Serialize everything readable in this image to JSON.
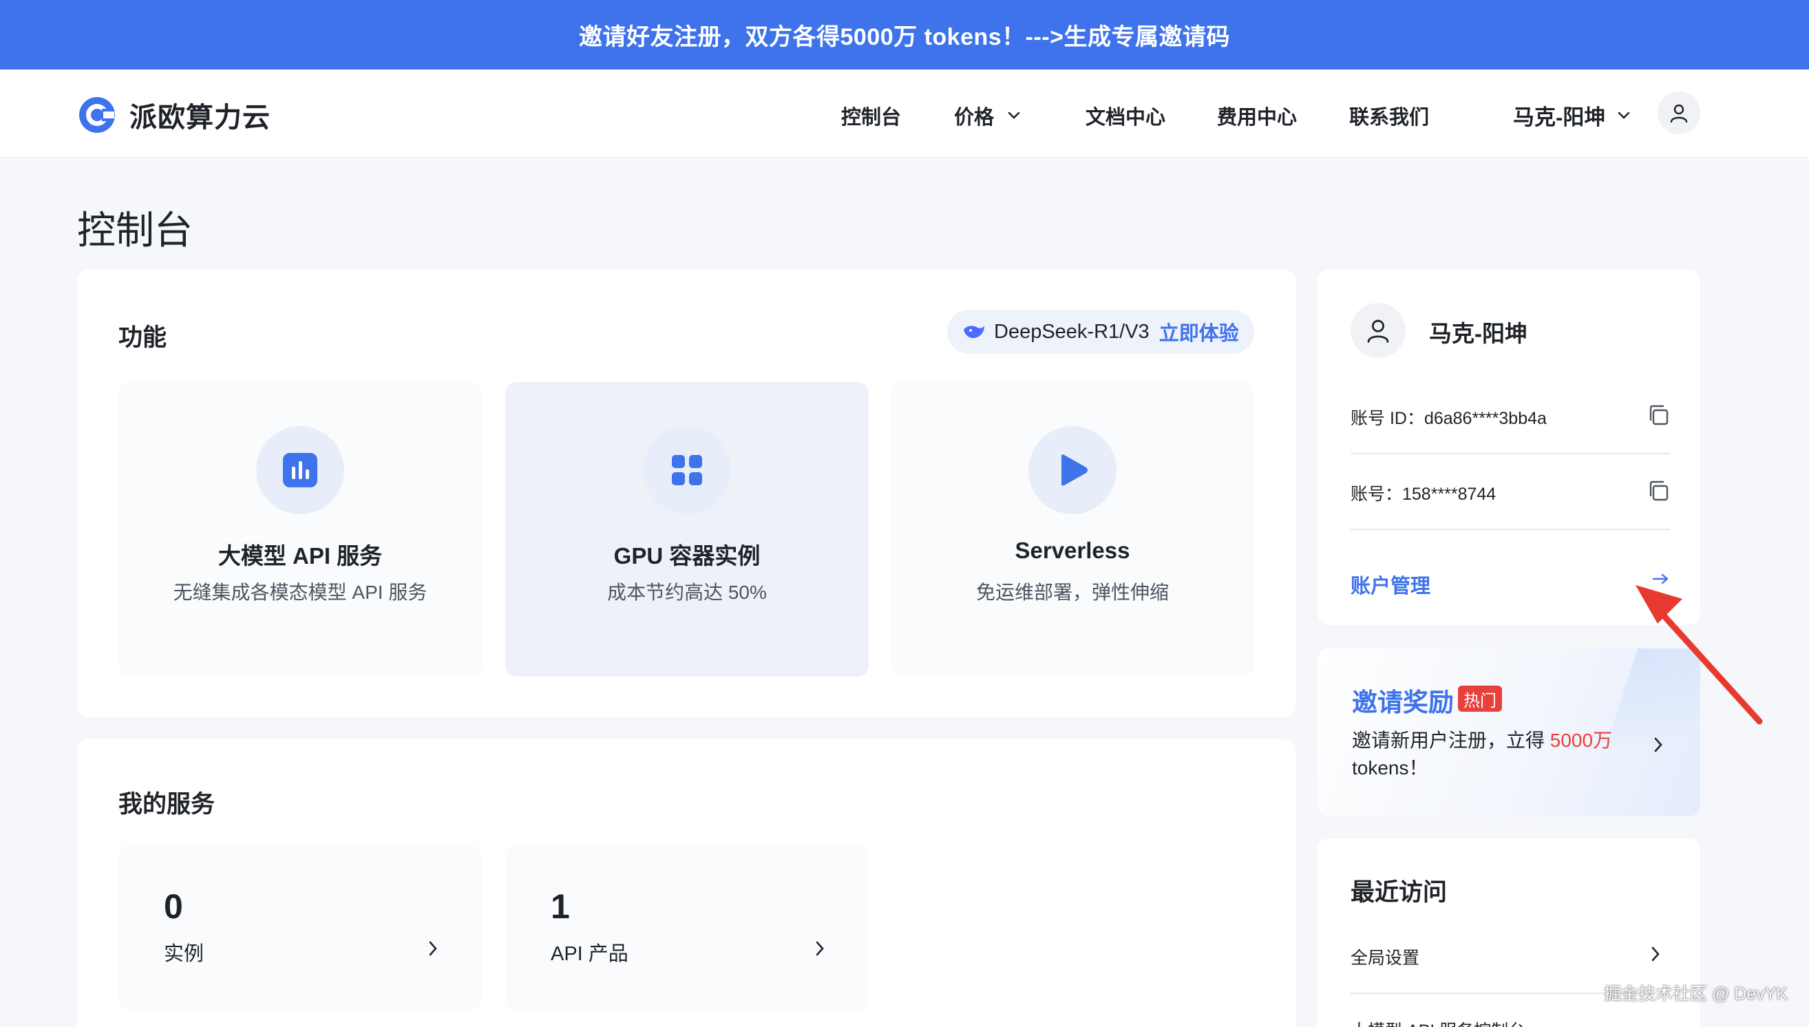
{
  "banner": {
    "text": "邀请好友注册，双方各得5000万 tokens！--->生成专属邀请码"
  },
  "header": {
    "brand": "派欧算力云",
    "nav": [
      "控制台",
      "价格",
      "文档中心",
      "费用中心",
      "联系我们"
    ],
    "user_name": "马克-阳坤"
  },
  "page": {
    "title": "控制台"
  },
  "features": {
    "title": "功能",
    "promo_model": "DeepSeek-R1/V3",
    "promo_link": "立即体验",
    "items": [
      {
        "title": "大模型 API 服务",
        "desc": "无缝集成各模态模型 API 服务",
        "icon": "bar-chart-icon"
      },
      {
        "title": "GPU 容器实例",
        "desc": "成本节约高达 50%",
        "icon": "grid-icon"
      },
      {
        "title": "Serverless",
        "desc": "免运维部署，弹性伸缩",
        "icon": "play-icon"
      }
    ]
  },
  "services": {
    "title": "我的服务",
    "items": [
      {
        "count": "0",
        "label": "实例"
      },
      {
        "count": "1",
        "label": "API 产品"
      }
    ]
  },
  "profile": {
    "name": "马克-阳坤",
    "account_id": "账号 ID：d6a86****3bb4a",
    "account": "账号：158****8744",
    "manage_label": "账户管理"
  },
  "invite": {
    "title": "邀请奖励",
    "badge": "热门",
    "desc_prefix": "邀请新用户注册，立得 ",
    "desc_highlight": "5000万",
    "desc_suffix": " tokens！"
  },
  "recent": {
    "title": "最近访问",
    "items": [
      "全局设置",
      "大模型 API 服务控制台"
    ]
  },
  "watermark": "掘金技术社区 @ DevYK",
  "colors": {
    "primary": "#3f73ec",
    "highlight": "#e8413c",
    "background": "#f5f7fa"
  }
}
